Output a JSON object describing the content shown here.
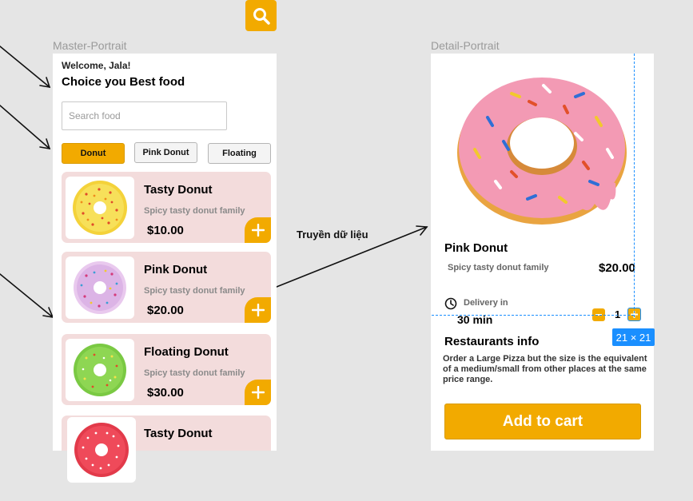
{
  "colors": {
    "accent": "#f2aa00",
    "card_bg": "#f3dcdc",
    "canvas": "#e5e5e5",
    "guide": "#1a8fff"
  },
  "toolbar": {
    "search_icon": "search-icon"
  },
  "frames": {
    "master_label": "Master-Portrait",
    "detail_label": "Detail-Portrait"
  },
  "master": {
    "welcome": "Welcome, Jala!",
    "headline": "Choice you Best food",
    "search": {
      "placeholder": "Search food",
      "value": ""
    },
    "chips": [
      {
        "label": "Donut",
        "active": true
      },
      {
        "label": "Pink Donut",
        "active": false
      },
      {
        "label": "Floating",
        "active": false
      }
    ],
    "items": [
      {
        "name": "Tasty Donut",
        "desc": "Spicy tasty donut family",
        "price": "$10.00"
      },
      {
        "name": "Pink Donut",
        "desc": "Spicy tasty donut family",
        "price": "$20.00"
      },
      {
        "name": "Floating Donut",
        "desc": "Spicy tasty donut family",
        "price": "$30.00"
      },
      {
        "name": "Tasty Donut"
      }
    ]
  },
  "arrow_label": "Truyền dữ liệu",
  "detail": {
    "name": "Pink Donut",
    "desc": "Spicy tasty donut family",
    "price": "$20.00",
    "delivery_label": "Delivery in",
    "delivery_time": "30 min",
    "quantity": "1",
    "section_title": "Restaurants info",
    "info": "Order a Large Pizza but the size is the equivalent of a medium/small from other places at the same price range.",
    "cart_label": "Add to cart"
  },
  "selection_badge": "21 × 21"
}
